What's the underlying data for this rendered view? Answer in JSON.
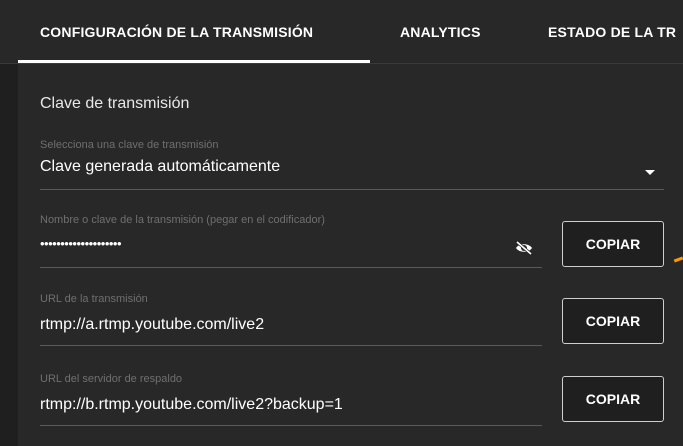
{
  "tabs": [
    {
      "label": "CONFIGURACIÓN DE LA TRANSMISIÓN",
      "active": true
    },
    {
      "label": "ANALYTICS",
      "active": false
    },
    {
      "label": "ESTADO DE LA TR",
      "active": false
    }
  ],
  "section": {
    "title": "Clave de transmisión"
  },
  "stream_key_select": {
    "label": "Selecciona una clave de transmisión",
    "value": "Clave generada automáticamente",
    "icon": "dropdown-arrow-icon"
  },
  "stream_key_field": {
    "label": "Nombre o clave de la transmisión (pegar en el codificador)",
    "value": "••••••••••••••••••••",
    "visibility_icon": "eye-off-icon",
    "copy_label": "COPIAR"
  },
  "stream_url_field": {
    "label": "URL de la transmisión",
    "value": "rtmp://a.rtmp.youtube.com/live2",
    "copy_label": "COPIAR"
  },
  "backup_url_field": {
    "label": "URL del servidor de respaldo",
    "value": "rtmp://b.rtmp.youtube.com/live2?backup=1",
    "copy_label": "COPIAR"
  },
  "colors": {
    "background": "#1f1f1f",
    "panel": "#282828",
    "text": "#ffffff",
    "muted_text": "#6f6f6f",
    "accent": "#ff9800"
  }
}
